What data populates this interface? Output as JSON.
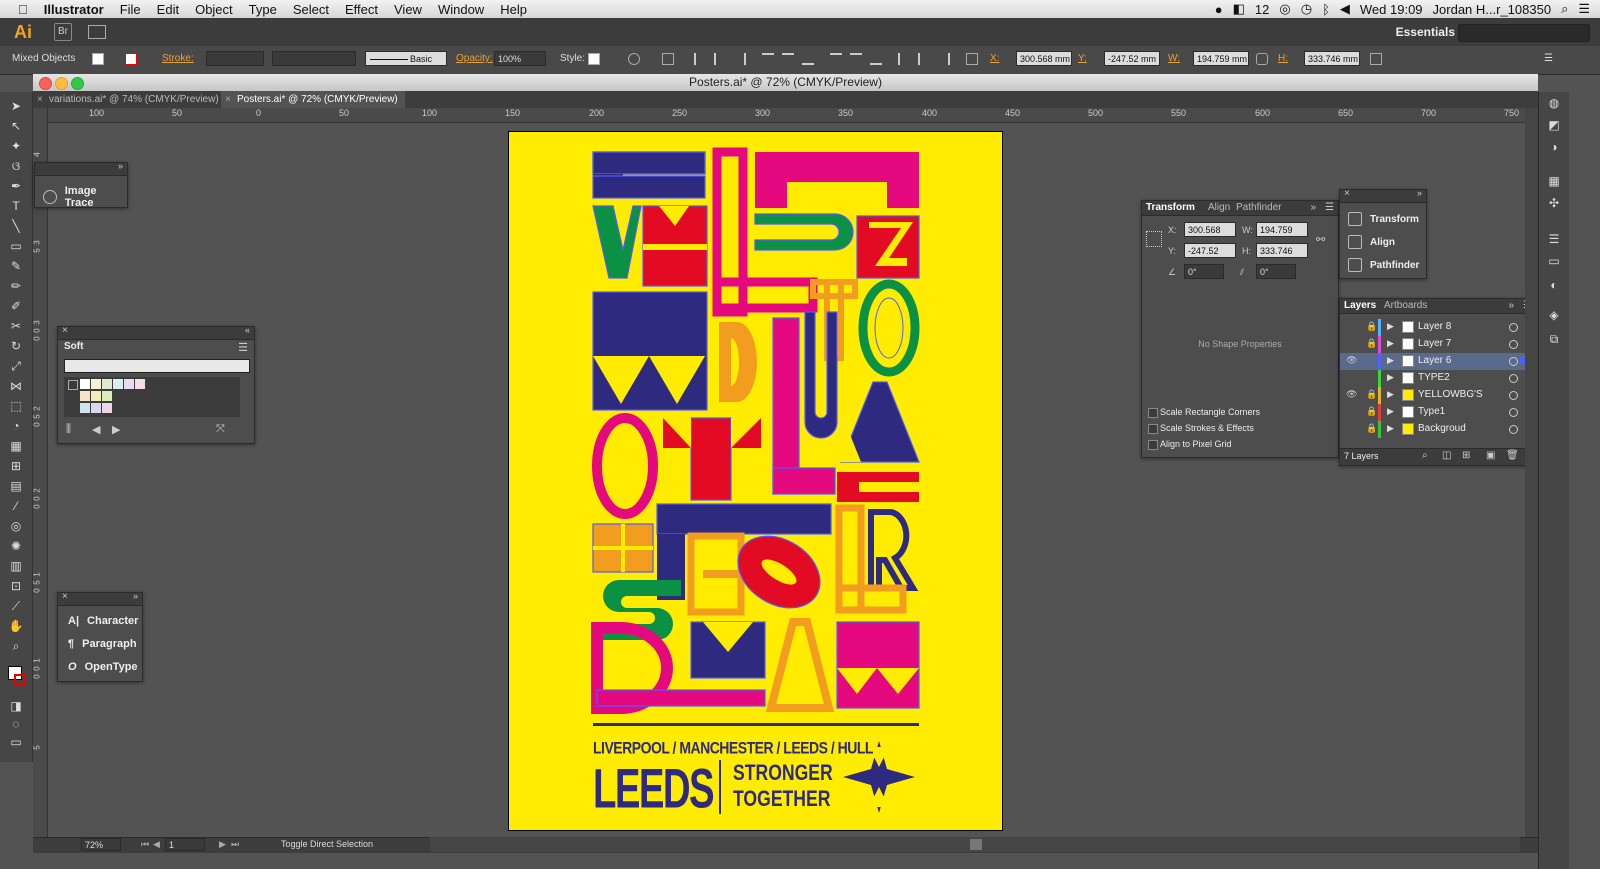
{
  "menubar": {
    "apple": "",
    "app": "Illustrator",
    "items": [
      "File",
      "Edit",
      "Object",
      "Type",
      "Select",
      "Effect",
      "View",
      "Window",
      "Help"
    ],
    "status": "12",
    "clock": "Wed 19:09",
    "user": "Jordan H...r_108350"
  },
  "appbar": {
    "logo": "Ai",
    "bridge": "Br",
    "workspace": "Essentials"
  },
  "control": {
    "selection": "Mixed Objects",
    "stroke_label": "Stroke:",
    "brush": "Basic",
    "opacity_label": "Opacity:",
    "opacity": "100%",
    "style_label": "Style:",
    "x_label": "X:",
    "x": "300.568 mm",
    "y_label": "Y:",
    "y": "-247.52 mm",
    "w_label": "W:",
    "w": "194.759 mm",
    "h_label": "H:",
    "h": "333.746 mm"
  },
  "document": {
    "title": "Posters.ai* @ 72% (CMYK/Preview)",
    "tabs": [
      {
        "label": "variations.ai* @ 74% (CMYK/Preview)"
      },
      {
        "label": "Posters.ai* @ 72% (CMYK/Preview)"
      }
    ]
  },
  "ruler": {
    "h": [
      "100",
      "50",
      "0",
      "50",
      "100",
      "150",
      "200",
      "250",
      "300",
      "350",
      "400",
      "450",
      "500",
      "550",
      "600",
      "650",
      "700",
      "750"
    ],
    "v": [
      "4",
      "3",
      "5",
      "3",
      "0",
      "0",
      "2",
      "5",
      "0",
      "2",
      "0",
      "0",
      "1",
      "5",
      "0",
      "1",
      "0",
      "0",
      "5"
    ]
  },
  "panels": {
    "image_trace": "Image Trace",
    "swatches": {
      "name": "Soft"
    },
    "character": {
      "items": [
        "Character",
        "Paragraph",
        "OpenType"
      ]
    },
    "transform": {
      "tabs": [
        "Transform",
        "Align",
        "Pathfinder"
      ],
      "x_label": "X:",
      "x": "300.568 mm",
      "w_label": "W:",
      "w": "194.759 mm",
      "y_label": "Y:",
      "y": "-247.52 mm",
      "h_label": "H:",
      "h": "333.746 mm",
      "rot": "0°",
      "shear": "0°",
      "empty": "No Shape Properties",
      "opts": [
        "Scale Rectangle Corners",
        "Scale Strokes & Effects",
        "Align to Pixel Grid"
      ]
    },
    "collapsed": {
      "items": [
        "Transform",
        "Align",
        "Pathfinder"
      ]
    },
    "layers": {
      "tabs": [
        "Layers",
        "Artboards"
      ],
      "rows": [
        {
          "name": "Layer 8",
          "color": "#4fb3ff",
          "eye": false,
          "lock": true
        },
        {
          "name": "Layer 7",
          "color": "#e24bd6",
          "eye": false,
          "lock": true
        },
        {
          "name": "Layer 6",
          "color": "#5360ff",
          "eye": true,
          "lock": false
        },
        {
          "name": "TYPE2",
          "color": "#3bd53b",
          "eye": false,
          "lock": false
        },
        {
          "name": "YELLOWBG'S",
          "color": "#e4b32a",
          "eye": true,
          "lock": true
        },
        {
          "name": "Type1",
          "color": "#e33c3c",
          "eye": false,
          "lock": true
        },
        {
          "name": "Backgroud",
          "color": "#33c733",
          "eye": false,
          "lock": true
        }
      ],
      "count": "7 Layers"
    }
  },
  "poster": {
    "cities": "LIVERPOOL / MANCHESTER / LEEDS / HULL",
    "city": "LEEDS",
    "tag1": "STRONGER",
    "tag2": "TOGETHER",
    "colors": {
      "bg": "#ffec00",
      "navy": "#2e2a80",
      "pink": "#e5097f",
      "red": "#e30b23",
      "green": "#0a9144",
      "orange": "#f29d1f"
    }
  },
  "status": {
    "zoom": "72%",
    "page": "1",
    "tool": "Toggle Direct Selection"
  }
}
